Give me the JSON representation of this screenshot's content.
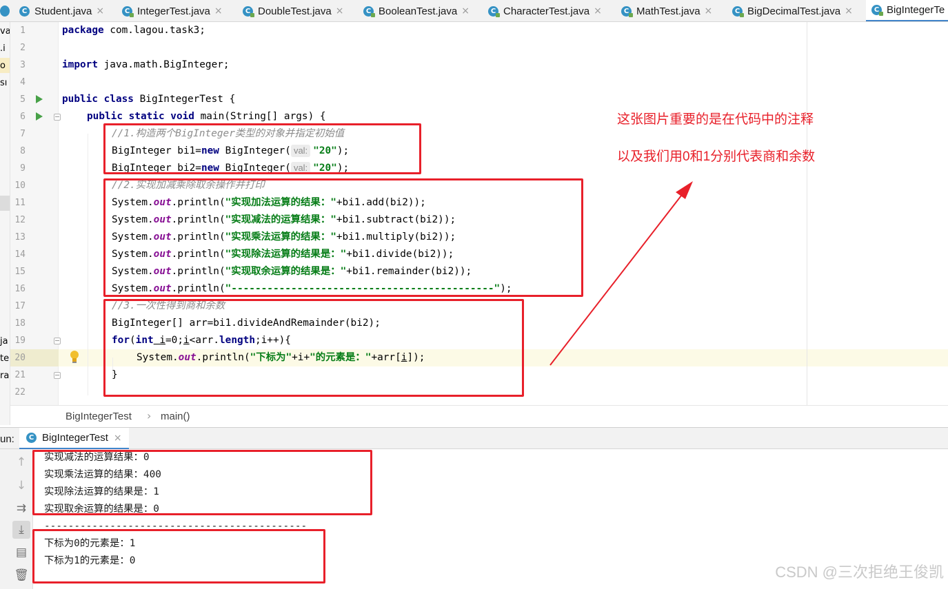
{
  "tabs": [
    {
      "label": "Student.java"
    },
    {
      "label": "IntegerTest.java"
    },
    {
      "label": "DoubleTest.java"
    },
    {
      "label": "BooleanTest.java"
    },
    {
      "label": "CharacterTest.java"
    },
    {
      "label": "MathTest.java"
    },
    {
      "label": "BigDecimalTest.java"
    },
    {
      "label": "BigIntegerTe"
    }
  ],
  "left_strip": [
    "va:",
    ".i",
    "o",
    "sı",
    "ja",
    "te",
    "ra"
  ],
  "line_numbers": [
    "1",
    "2",
    "3",
    "4",
    "5",
    "6",
    "7",
    "8",
    "9",
    "10",
    "11",
    "12",
    "13",
    "14",
    "15",
    "16",
    "17",
    "18",
    "19",
    "20",
    "21",
    "22"
  ],
  "code": {
    "l1_kw": "package",
    "l1_rest": " com.lagou.task3;",
    "l3_kw": "import",
    "l3_rest": " java.math.BigInteger;",
    "l5_kw": "public class",
    "l5_rest": " BigIntegerTest {",
    "l6_kw": "public static void",
    "l6_rest": " main(String[] args) {",
    "l7_comment": "//1.构造两个BigInteger类型的对象并指定初始值",
    "l8_a": "BigInteger bi1=",
    "l8_new": "new",
    "l8_b": " BigInteger(",
    "hint_val": "val:",
    "l8_str": "\"20\"",
    "l8_end": ");",
    "l9_a": "BigInteger bi2=",
    "l9_new": "new",
    "l9_b": " BigInteger(",
    "l9_str": "\"20\"",
    "l9_end": ");",
    "l10_comment": "//2.实现加减乘除取余操作并打印",
    "sys": "System.",
    "out": "out",
    "println": ".println(",
    "l11_str": "\"实现加法运算的结果：\"",
    "l11_rest": "+bi1.add(bi2));",
    "l12_str": "\"实现减法的运算结果：\"",
    "l12_rest": "+bi1.subtract(bi2));",
    "l13_str": "\"实现乘法运算的结果：\"",
    "l13_rest": "+bi1.multiply(bi2));",
    "l14_str": "\"实现除法运算的结果是：\"",
    "l14_rest": "+bi1.divide(bi2));",
    "l15_str": "\"实现取余运算的结果是：\"",
    "l15_rest": "+bi1.remainder(bi2));",
    "l16_str": "\"--------------------------------------------\"",
    "l16_rest": ");",
    "l17_comment": "//3.一次性得到商和余数",
    "l18": "BigInteger[] arr=bi1.divideAndRemainder(bi2);",
    "l19_for": "for",
    "l19_open": "(",
    "l19_int": "int",
    "l19_i1": " i",
    "l19_mid": "=0;",
    "l19_i2": "i",
    "l19_mid2": "<arr.",
    "l19_length": "length",
    "l19_end": ";i++){",
    "l20_str1": "\"下标为\"",
    "l20_mid": "+i+",
    "l20_str2": "\"的元素是：\"",
    "l20_a": "+arr[",
    "l20_i": "i",
    "l20_b": "]);",
    "l21": "}"
  },
  "breadcrumb": {
    "class": "BigIntegerTest",
    "method": "main()",
    "sep": "›"
  },
  "run": {
    "label": "un:",
    "tab": "BigIntegerTest"
  },
  "console": [
    "实现减法的运算结果：0",
    "实现乘法运算的结果：400",
    "实现除法运算的结果是：1",
    "实现取余运算的结果是：0",
    "--------------------------------------------",
    "下标为0的元素是：1",
    "下标为1的元素是：0"
  ],
  "annotation": {
    "line1": "这张图片重要的是在代码中的注释",
    "line2": "以及我们用0和1分别代表商和余数",
    "color": "#e8202a"
  },
  "watermark": "CSDN @三次拒绝王俊凯",
  "colors": {
    "keyword": "#000080",
    "string": "#067d17",
    "comment": "#8c8c8c",
    "static_field": "#871094",
    "run_icon": "#48a148",
    "tab_accent": "#4083c9"
  }
}
